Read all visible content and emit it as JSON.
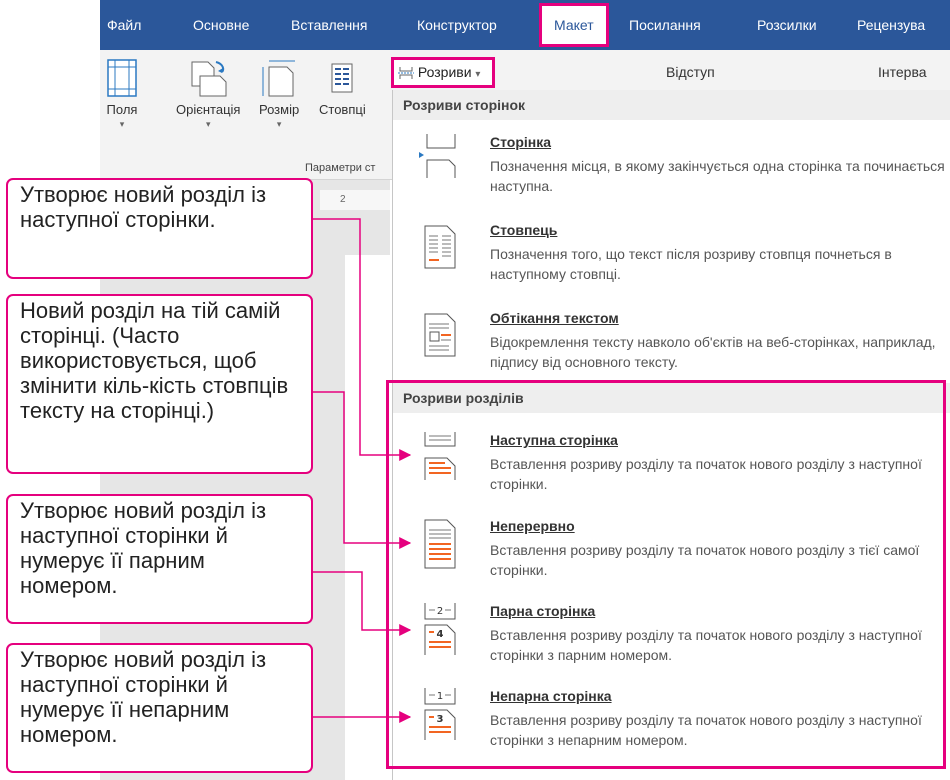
{
  "tabs": [
    "Файл",
    "Основне",
    "Вставлення",
    "Конструктор",
    "Макет",
    "Посилання",
    "Розсилки",
    "Рецензува"
  ],
  "ribbon": {
    "fields": "Поля",
    "orientation": "Орієнтація",
    "size": "Розмір",
    "columns": "Стовпці",
    "group_caption": "Параметри ст",
    "breaks": "Розриви",
    "indent": "Відступ",
    "spacing": "Інтерва",
    "ruler": "2"
  },
  "menu": {
    "page_breaks_header": "Розриви сторінок",
    "section_breaks_header": "Розриви розділів",
    "items": [
      {
        "title": "Сторінка",
        "desc": "Позначення місця, в якому закінчується одна сторінка та починається наступна.",
        "icon": "page-break-icon"
      },
      {
        "title": "Стовпець",
        "desc": "Позначення того, що текст після розриву стовпця почнеться в наступному стовпці.",
        "icon": "column-break-icon"
      },
      {
        "title": "Обтікання текстом",
        "desc": "Відокремлення тексту навколо об'єктів на веб-сторінках, наприклад, підпису від основного тексту.",
        "icon": "text-wrapping-icon"
      },
      {
        "title": "Наступна сторінка",
        "desc": "Вставлення розриву розділу та початок нового розділу з наступної сторінки.",
        "icon": "next-page-section-icon"
      },
      {
        "title": "Неперервно",
        "desc": "Вставлення розриву розділу та початок нового розділу з тієї самої сторінки.",
        "icon": "continuous-section-icon"
      },
      {
        "title": "Парна сторінка",
        "desc": "Вставлення розриву розділу та початок нового розділу з наступної сторінки з парним номером.",
        "icon": "even-page-section-icon"
      },
      {
        "title": "Непарна сторінка",
        "desc": "Вставлення розриву розділу та початок нового розділу з наступної сторінки з непарним номером.",
        "icon": "odd-page-section-icon"
      }
    ]
  },
  "callouts": [
    "Утворює новий розділ із наступної сторінки.",
    "Новий розділ на тій самій сторінці. (Часто використовується, щоб змінити кіль-кість стовпців тексту на сторінці.)",
    "Утворює новий розділ із наступної сторінки й нумерує її парним номером.",
    "Утворює новий розділ із наступної сторінки й нумерує її непарним номером."
  ],
  "colors": {
    "accent": "#e5007e",
    "ribbon_blue": "#2b579a",
    "icon_orange": "#f26522"
  }
}
